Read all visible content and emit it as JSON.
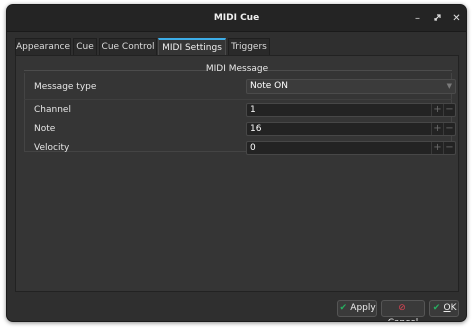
{
  "window": {
    "title": "MIDI Cue",
    "controls": {
      "minimize": "minimize-icon",
      "restore": "restore-icon",
      "close": "close-icon"
    }
  },
  "tabs": [
    {
      "label": "Appearance",
      "active": false
    },
    {
      "label": "Cue",
      "active": false
    },
    {
      "label": "Cue Control",
      "active": false
    },
    {
      "label": "MIDI Settings",
      "active": true
    },
    {
      "label": "Triggers",
      "active": false
    }
  ],
  "midi_message": {
    "section_title": "MIDI Message",
    "message_type": {
      "label": "Message type",
      "value": "Note ON"
    },
    "channel": {
      "label": "Channel",
      "value": "1"
    },
    "note": {
      "label": "Note",
      "value": "16"
    },
    "velocity": {
      "label": "Velocity",
      "value": "0"
    }
  },
  "buttons": {
    "apply": {
      "label": "Apply",
      "icon": "checkmark-icon"
    },
    "cancel": {
      "label_first": "C",
      "label_rest": "ancel",
      "icon": "cancel-icon"
    },
    "ok": {
      "label_first": "O",
      "label_rest": "K",
      "icon": "checkmark-icon"
    }
  },
  "colors": {
    "window_bg": "#2f2f2f",
    "panel_bg": "#353535",
    "accent": "#3daee9",
    "check_green": "#27ae60",
    "cancel_red": "#da4453"
  }
}
